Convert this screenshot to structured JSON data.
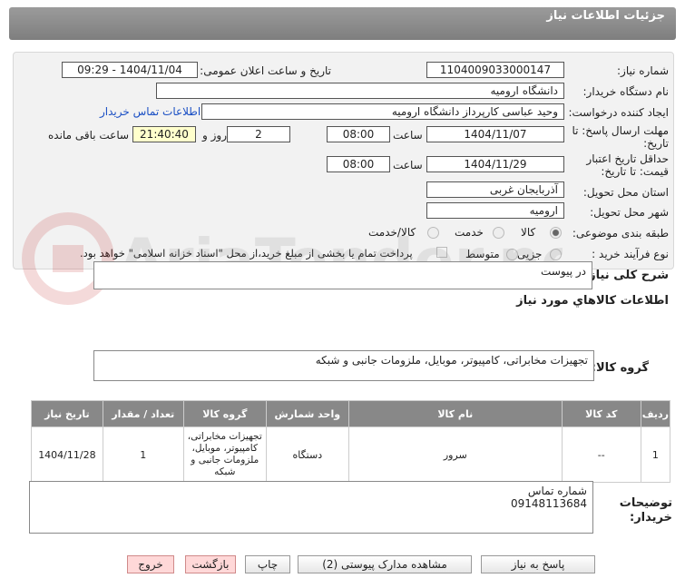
{
  "header": {
    "title": "جزئیات اطلاعات نیاز"
  },
  "labels": {
    "need_number": "شماره نیاز:",
    "announce_datetime": "تاریخ و ساعت اعلان عمومی:",
    "buyer_org": "نام دستگاه خریدار:",
    "requester": "ایجاد کننده درخواست:",
    "contact_link": "اطلاعات تماس خریدار",
    "reply_deadline_1": "مهلت ارسال پاسخ: تا",
    "reply_deadline_2": "تاریخ:",
    "time": "ساعت",
    "time2": "ساعت",
    "day_and": "روز و",
    "time_remaining": "ساعت باقی مانده",
    "price_validity_1": "حداقل تاریخ اعتبار",
    "price_validity_2": "قیمت: تا تاریخ:",
    "province": "استان محل تحویل:",
    "city": "شهر محل تحویل:",
    "category": "طبقه بندی موضوعی:",
    "purchase_type": "نوع فرآیند خرید :",
    "description": "شرح کلی نیاز:",
    "goods_info": "اطلاعات کالاهاي مورد نياز",
    "goods_group": "گروه کالا:",
    "buyer_notes_1": "توضیحات",
    "buyer_notes_2": "خریدار:"
  },
  "values": {
    "need_number": "1104009033000147",
    "announce_datetime": "1404/11/04 - 09:29",
    "buyer_org": "دانشگاه ارومیه",
    "requester": "وحید عباسی کارپرداز دانشگاه ارومیه",
    "reply_date": "1404/11/07",
    "reply_time": "08:00",
    "days": "2",
    "remaining": "21:40:40",
    "validity_date": "1404/11/29",
    "validity_time": "08:00",
    "province": "آذربایجان غربی",
    "city": "ارومیه",
    "description": "در پیوست",
    "goods_group": "تجهیزات مخابراتی، کامپیوتر، موبایل، ملزومات جانبی و شبکه",
    "notes_line1": "شماره تماس",
    "notes_line2": "09148113684"
  },
  "category_options": [
    "کالا",
    "خدمت",
    "کالا/خدمت"
  ],
  "category_selected": "کالا",
  "purchase_options": [
    "جزیی",
    "متوسط"
  ],
  "payment_note": "پرداخت تمام یا بخشی از مبلغ خرید،از محل \"اسناد خزانه اسلامی\" خواهد بود.",
  "table": {
    "headers": [
      "ردیف",
      "کد کالا",
      "نام کالا",
      "واحد شمارش",
      "گروه کالا",
      "تعداد / مقدار",
      "تاریخ نیاز"
    ],
    "rows": [
      [
        "1",
        "--",
        "سرور",
        "دستگاه",
        "تجهیزات مخابراتی، کامپیوتر، موبایل، ملزومات جانبی و شبکه",
        "1",
        "1404/11/28"
      ]
    ]
  },
  "buttons": {
    "reply": "پاسخ به نیاز",
    "attachments": "مشاهده مدارک پیوستی (2)",
    "print": "چاپ",
    "back": "بازگشت",
    "exit": "خروج"
  },
  "watermark": "AriaTender.net",
  "colors": {
    "header": "#8a8a8a",
    "link": "#1a4fc4",
    "highlight": "#ffffcc",
    "danger_button": "#ffd8d8"
  }
}
